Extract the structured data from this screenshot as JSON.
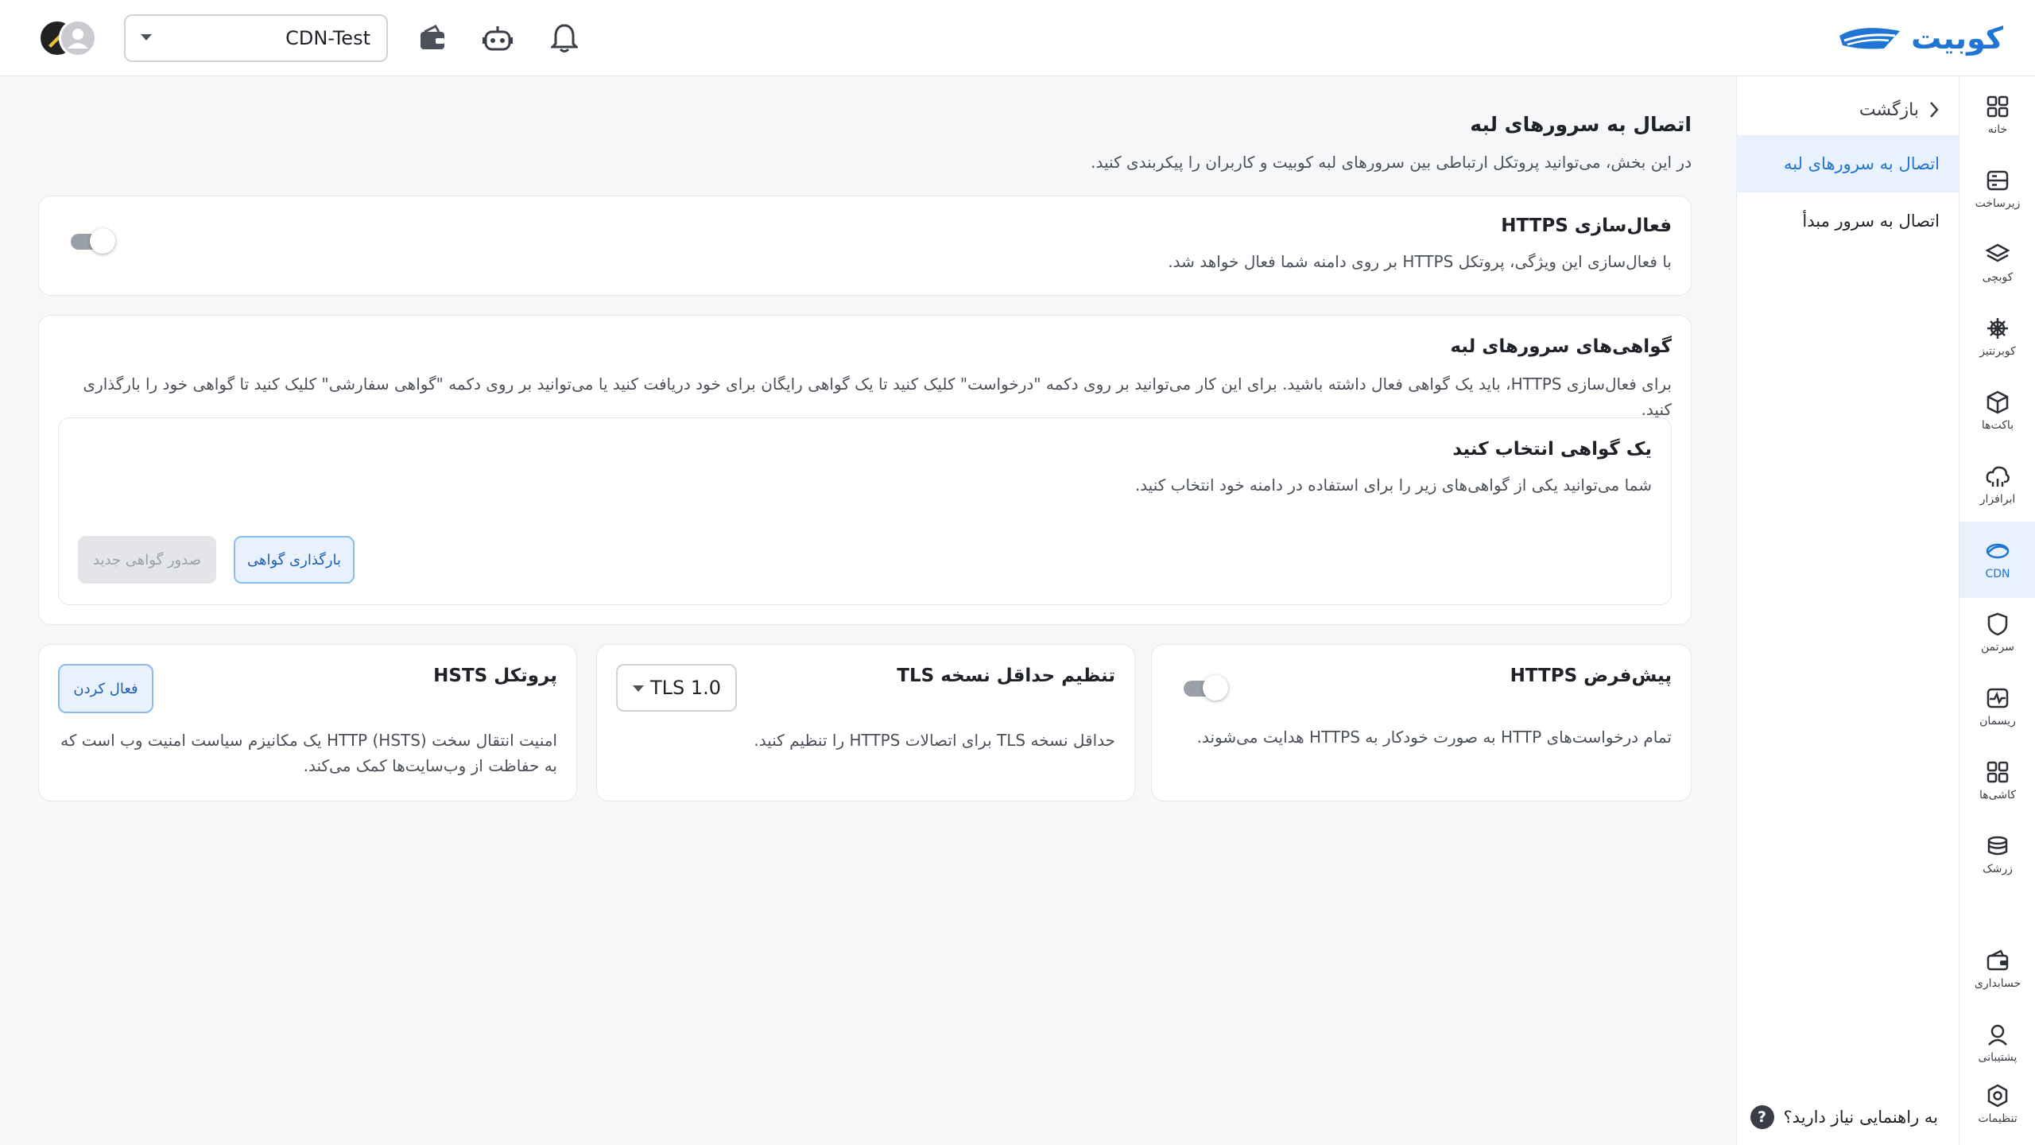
{
  "brand": {
    "name": "کوبیت",
    "color": "#1f74d4"
  },
  "topbar": {
    "project": "CDN-Test",
    "icons": [
      "wallet-icon",
      "bot-icon",
      "bell-icon"
    ]
  },
  "rail": {
    "items": [
      {
        "label": "خانه",
        "icon": "home-grid-icon"
      },
      {
        "label": "زیرساخت",
        "icon": "server-icon"
      },
      {
        "label": "کوبچی",
        "icon": "layers-icon"
      },
      {
        "label": "کوبرنتیز",
        "icon": "helm-icon"
      },
      {
        "label": "باکت‌ها",
        "icon": "box-icon"
      },
      {
        "label": "ابرافزار",
        "icon": "cloud-app-icon"
      },
      {
        "label": "CDN",
        "icon": "cdn-icon",
        "active": true
      },
      {
        "label": "سرتمن",
        "icon": "shield-icon"
      },
      {
        "label": "ریسمان",
        "icon": "pulse-icon"
      },
      {
        "label": "کاشی‌ها",
        "icon": "tiles-icon"
      },
      {
        "label": "زرشک",
        "icon": "database-icon"
      },
      {
        "label": "حسابداری",
        "icon": "wallet-icon"
      },
      {
        "label": "پشتیبانی",
        "icon": "support-icon"
      },
      {
        "label": "تنظیمات",
        "icon": "settings-icon"
      }
    ]
  },
  "subnav": {
    "back": "بازگشت",
    "items": [
      {
        "label": "اتصال به سرورهای لبه",
        "active": true
      },
      {
        "label": "اتصال به سرور مبدأ"
      }
    ],
    "help": "به راهنمایی نیاز دارید؟"
  },
  "page": {
    "title": "اتصال به سرورهای لبه",
    "description": "در این بخش، می‌توانید پروتکل ارتباطی بین سرورهای لبه کوبیت و کاربران را پیکربندی کنید."
  },
  "https_card": {
    "title": "فعال‌سازی HTTPS",
    "description": "با فعال‌سازی این ویژگی، پروتکل HTTPS بر روی دامنه شما فعال خواهد شد.",
    "enabled": false
  },
  "cert_card": {
    "title": "گواهی‌های سرورهای لبه",
    "description": "برای فعال‌سازی HTTPS، باید یک گواهی فعال داشته باشید. برای این کار می‌توانید بر روی دکمه \"درخواست\" کلیک کنید تا یک گواهی رایگان برای خود دریافت کنید یا می‌توانید بر روی دکمه \"گواهی سفارشی\" کلیک کنید تا گواهی خود را بارگذاری کنید.",
    "select_title": "یک گواهی انتخاب کنید",
    "select_description": "شما می‌توانید یکی از گواهی‌های زیر را برای استفاده در دامنه خود انتخاب کنید.",
    "upload_button": "بارگذاری گواهی",
    "issue_button": "صدور گواهی جدید"
  },
  "default_https_card": {
    "title": "پیش‌فرض HTTPS",
    "description": "تمام درخواست‌های HTTP به صورت خودکار به HTTPS هدایت می‌شوند.",
    "enabled": false
  },
  "tls_card": {
    "title": "تنظیم حداقل نسخه TLS",
    "description": "حداقل نسخه TLS برای اتصالات HTTPS را تنظیم کنید.",
    "selected": "TLS 1.0"
  },
  "hsts_card": {
    "title": "پروتکل HSTS",
    "description_line1": "امنیت انتقال سخت HTTP (HSTS) یک مکانیزم سیاست امنیت وب است که",
    "description_line2": "به حفاظت از وب‌سایت‌ها کمک می‌کند.",
    "button": "فعال کردن"
  }
}
